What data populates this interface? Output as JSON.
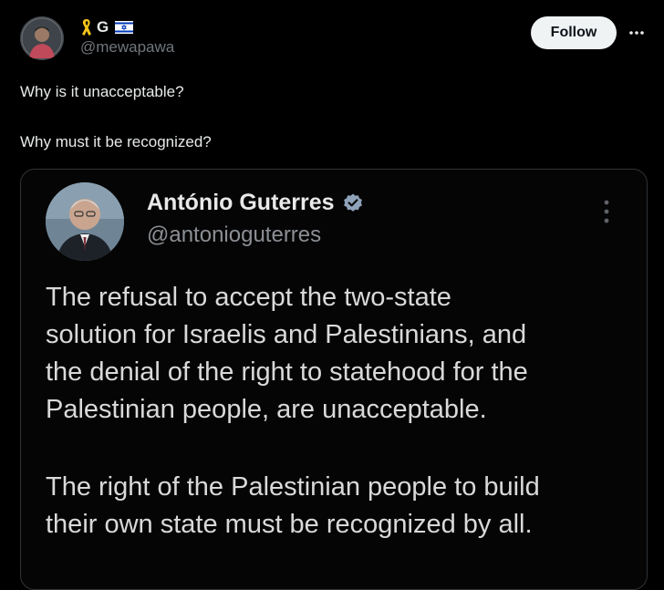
{
  "author": {
    "display_name": "G",
    "handle": "@mewapawa",
    "ribbon_color": "#f5c518",
    "flag_colors": {
      "field": "#ffffff",
      "stripes": "#0038b8"
    }
  },
  "follow_button": {
    "label": "Follow"
  },
  "more_icon": "more-horizontal-icon",
  "tweet": {
    "lines": [
      "Why is it unacceptable?",
      "Why must it be recognized?"
    ]
  },
  "quoted": {
    "name": "António Guterres",
    "handle": "@antonioguterres",
    "verified_color": "#8ea3ba",
    "more_icon": "more-vertical-icon",
    "paragraph1": [
      "The refusal to accept the two-state",
      "solution for Israelis and Palestinians, and",
      "the denial of the right to statehood for the",
      "Palestinian people, are unacceptable."
    ],
    "paragraph2": [
      "The right of the Palestinian people to build",
      "their own state must be recognized by all."
    ]
  }
}
